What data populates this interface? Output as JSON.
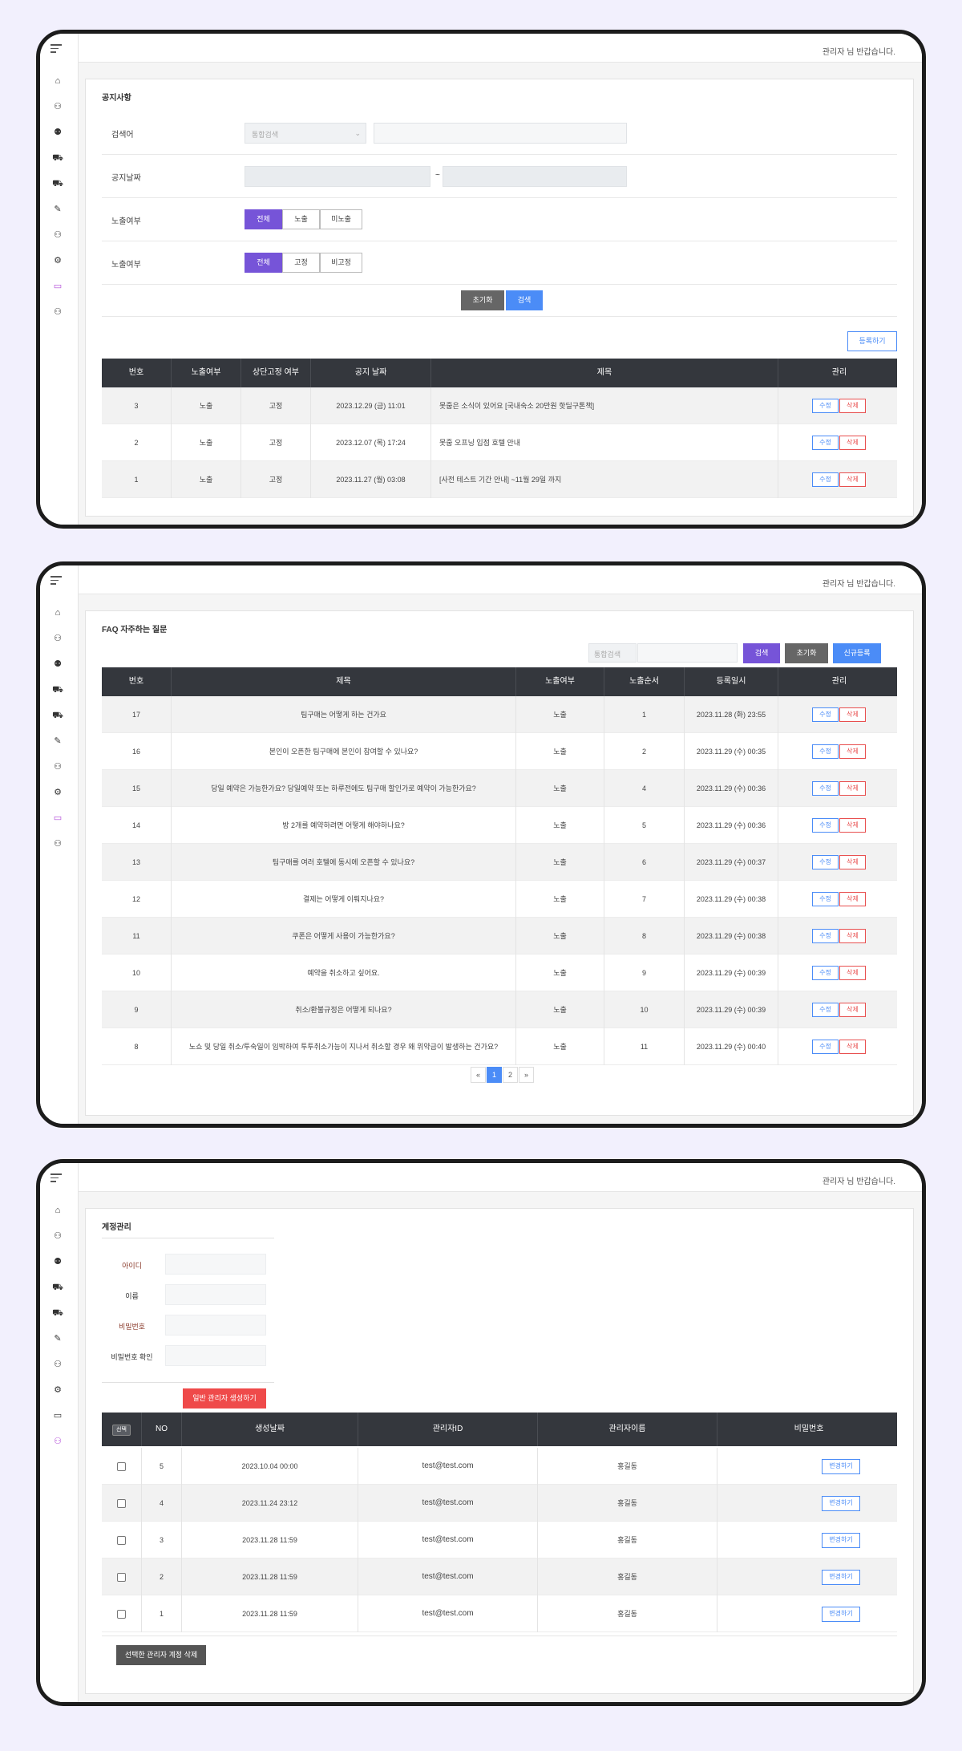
{
  "header": {
    "greeting": "관리자 님 반갑습니다."
  },
  "notice": {
    "title": "공지사항",
    "search_label": "검색어",
    "search_select": "통합검색",
    "date_label": "공지날짜",
    "date_sep": "~",
    "expose_label": "노출여부",
    "expose_options": [
      "전체",
      "노출",
      "미노출"
    ],
    "fixed_label": "노출여부",
    "fixed_options": [
      "전체",
      "고정",
      "비고정"
    ],
    "reset_button": "초기화",
    "search_button": "검색",
    "register_button": "등록하기",
    "columns": [
      "번호",
      "노출여부",
      "상단고정 여부",
      "공지 날짜",
      "제목",
      "관리"
    ],
    "rows": [
      {
        "no": "3",
        "expose": "노출",
        "fixed": "고정",
        "date": "2023.12.29 (금) 11:01",
        "title": "못줍은 소식이 있어요 [국내숙소 20만원 핫딜구톤책]"
      },
      {
        "no": "2",
        "expose": "노출",
        "fixed": "고정",
        "date": "2023.12.07 (목) 17:24",
        "title": "못줍 오프닝 입점 호텔 안내"
      },
      {
        "no": "1",
        "expose": "노출",
        "fixed": "고정",
        "date": "2023.11.27 (월) 03:08",
        "title": "[사전 테스트 기간 안내] ~11월 29일 까지"
      }
    ],
    "edit_label": "수정",
    "delete_label": "삭제"
  },
  "faq": {
    "title": "FAQ 자주하는 질문",
    "search_select": "통합검색",
    "search_button": "검색",
    "reset_button": "초기화",
    "new_button": "신규등록",
    "columns": [
      "번호",
      "제목",
      "노출여부",
      "노출순서",
      "등록일시",
      "관리"
    ],
    "rows": [
      {
        "no": "17",
        "title": "팀구매는 어떻게 하는 건가요",
        "expose": "노출",
        "order": "1",
        "date": "2023.11.28 (화) 23:55"
      },
      {
        "no": "16",
        "title": "본인이 오픈한 팀구매에 본인이 참여할 수 있나요?",
        "expose": "노출",
        "order": "2",
        "date": "2023.11.29 (수) 00:35"
      },
      {
        "no": "15",
        "title": "당일 예약은 가능한가요? 당일예약 또는 하루전에도 팀구매 할인가로 예약이 가능한가요?",
        "expose": "노출",
        "order": "4",
        "date": "2023.11.29 (수) 00:36"
      },
      {
        "no": "14",
        "title": "방 2개를 예약하려면 어떻게 해야하나요?",
        "expose": "노출",
        "order": "5",
        "date": "2023.11.29 (수) 00:36"
      },
      {
        "no": "13",
        "title": "팀구매를 여러 호텔에 동시에 오픈할 수 있나요?",
        "expose": "노출",
        "order": "6",
        "date": "2023.11.29 (수) 00:37"
      },
      {
        "no": "12",
        "title": "결제는 어떻게 이뤄지나요?",
        "expose": "노출",
        "order": "7",
        "date": "2023.11.29 (수) 00:38"
      },
      {
        "no": "11",
        "title": "쿠폰은 어떻게 사용이 가능한가요?",
        "expose": "노출",
        "order": "8",
        "date": "2023.11.29 (수) 00:38"
      },
      {
        "no": "10",
        "title": "예약을 취소하고 싶어요.",
        "expose": "노출",
        "order": "9",
        "date": "2023.11.29 (수) 00:39"
      },
      {
        "no": "9",
        "title": "취소/환불규정은 어떻게 되나요?",
        "expose": "노출",
        "order": "10",
        "date": "2023.11.29 (수) 00:39"
      },
      {
        "no": "8",
        "title": "노쇼 및 당일 취소/투숙일이 임박하여 투투취소가능이 지나서 취소할 경우 왜 위약금이 발생하는 건가요?",
        "expose": "노출",
        "order": "11",
        "date": "2023.11.29 (수) 00:40"
      }
    ],
    "edit_label": "수정",
    "delete_label": "삭제",
    "pagination": {
      "prev": "«",
      "pages": [
        "1",
        "2"
      ],
      "next": "»"
    }
  },
  "account": {
    "title": "계정관리",
    "id_label": "아이디",
    "name_label": "이름",
    "password_label": "비밀번호",
    "password_confirm_label": "비밀번호 확인",
    "create_button": "일반 관리자 생성하기",
    "columns": [
      "선택",
      "NO",
      "생성날짜",
      "관리자ID",
      "관리자이름",
      "비밀번호"
    ],
    "rows": [
      {
        "no": "5",
        "date": "2023.10.04 00:00",
        "id": "test@test.com",
        "name": "홍길동"
      },
      {
        "no": "4",
        "date": "2023.11.24 23:12",
        "id": "test@test.com",
        "name": "홍길동"
      },
      {
        "no": "3",
        "date": "2023.11.28 11:59",
        "id": "test@test.com",
        "name": "홍길동"
      },
      {
        "no": "2",
        "date": "2023.11.28 11:59",
        "id": "test@test.com",
        "name": "홍길동"
      },
      {
        "no": "1",
        "date": "2023.11.28 11:59",
        "id": "test@test.com",
        "name": "홍길동"
      }
    ],
    "change_label": "변경하기",
    "delete_selected_button": "선택한 관리자 계정 삭제"
  },
  "sidebar_icons": [
    "home-icon",
    "user-icon",
    "group-icon",
    "cart-icon",
    "cart-icon",
    "magic-icon",
    "user-icon",
    "gear-icon",
    "card-icon",
    "user-icon"
  ]
}
